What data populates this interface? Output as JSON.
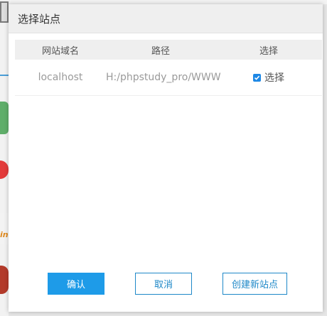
{
  "dialog": {
    "title": "选择站点",
    "columns": [
      "网站域名",
      "路径",
      "选择"
    ],
    "rows": [
      {
        "domain": "localhost",
        "path": "H:/phpstudy_pro/WWW",
        "select_label": "选择",
        "checked": true
      }
    ],
    "buttons": {
      "confirm": "确认",
      "cancel": "取消",
      "create": "创建新站点"
    }
  },
  "background": {
    "orange_text": "in"
  },
  "colors": {
    "accent": "#1e9be8",
    "header_bg": "#efefef"
  }
}
